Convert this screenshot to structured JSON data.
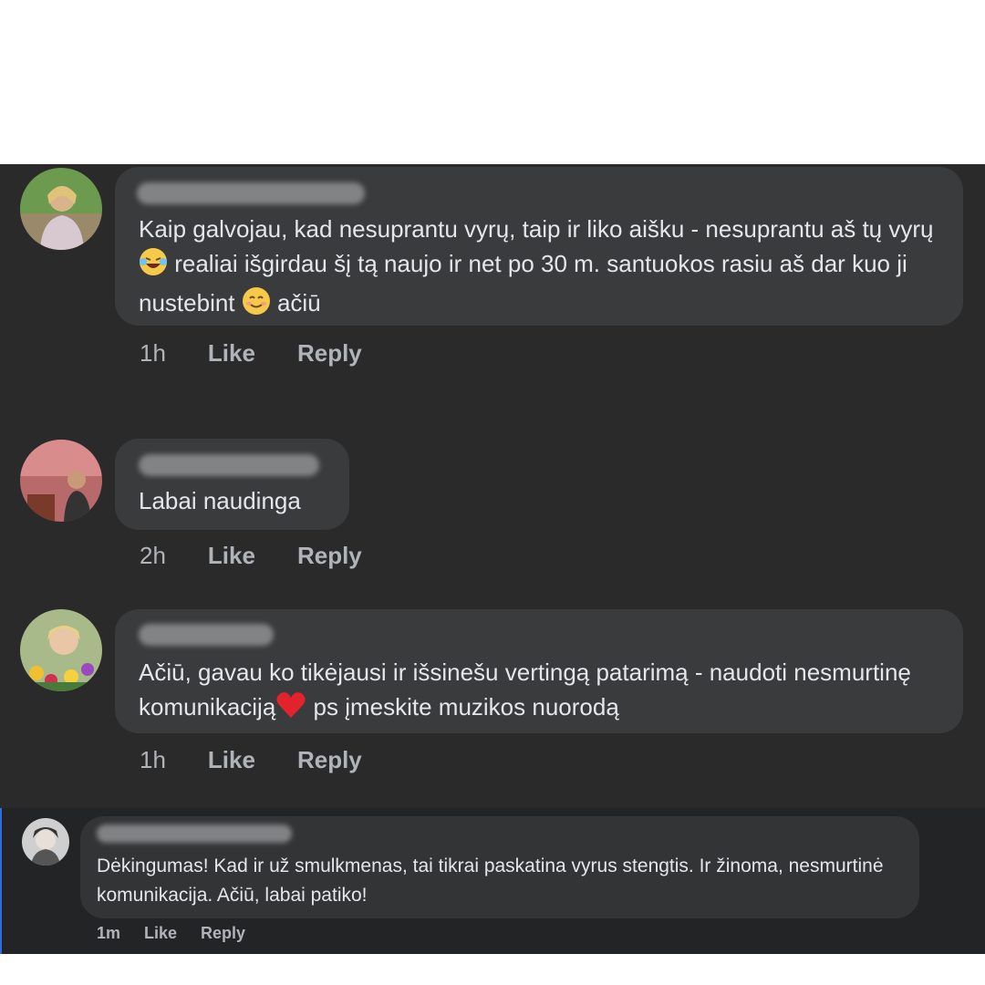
{
  "comments": [
    {
      "text": "Kaip galvojau, kad nesuprantu vyrų, taip ir liko aišku - nesuprantu aš tų vyrų ",
      "text2": " realiai išgirdau šį tą naujo ir net po 30 m. santuokos rasiu aš dar kuo ji nustebint ",
      "text3": " ačiū",
      "time": "1h",
      "like": "Like",
      "reply": "Reply"
    },
    {
      "text": "Labai naudinga",
      "time": "2h",
      "like": "Like",
      "reply": "Reply"
    },
    {
      "text": "Ačiū, gavau ko tikėjausi ir išsinešu vertingą patarimą - naudoti nesmurtinę komunikaciją",
      "text2": " ps įmeskite muzikos nuorodą",
      "time": "1h",
      "like": "Like",
      "reply": "Reply"
    },
    {
      "text": "Dėkingumas! Kad ir už smulkmenas, tai tikrai paskatina vyrus stengtis. Ir žinoma, nesmurtinė komunikacija. Ačiū, labai patiko!",
      "time": "1m",
      "like": "Like",
      "reply": "Reply"
    }
  ],
  "colors": {
    "panel": "#2a2a2b",
    "bubble": "#3a3b3c",
    "text": "#e4e6eb",
    "meta": "#b0b3b8"
  }
}
